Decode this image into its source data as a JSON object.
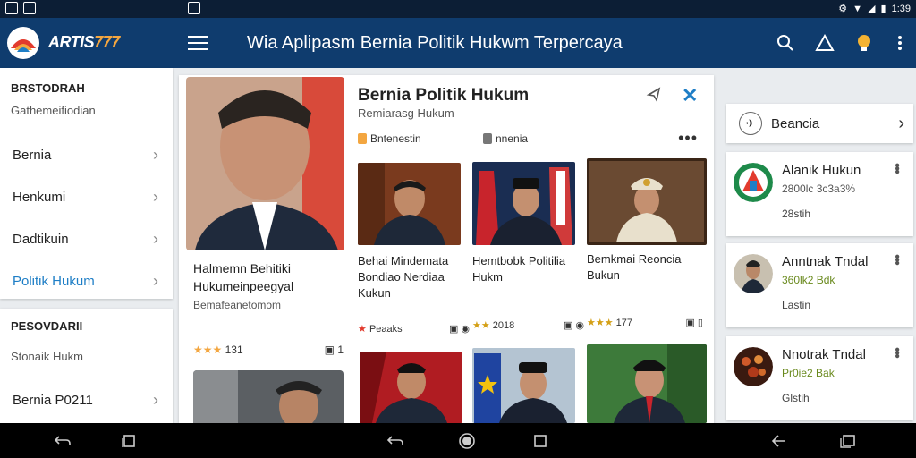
{
  "status": {
    "time": "1:39"
  },
  "app": {
    "brand_text": "ARTIS",
    "brand_num": "777",
    "title": "Wia Aplipasm Bernia Politik Hukwm Terpercaya"
  },
  "drawer": {
    "section1_heading": "BRSTODRAH",
    "section1_sub": "Gathemeifiodian",
    "items": [
      {
        "label": "Bernia"
      },
      {
        "label": "Henkumi"
      },
      {
        "label": "Dadtikuin"
      },
      {
        "label": "Politik Hukum"
      }
    ],
    "section2_heading": "PESOVDARII",
    "section2_sub": "Stonaik Hukm",
    "section2_item": "Bernia P0211"
  },
  "main": {
    "title": "Bernia Politik Hukum",
    "subtitle": "Remiarasg Hukum",
    "chip1": "Bntenestin",
    "chip2": "nnenia",
    "featured": {
      "title": "Halmemn Behitiki Hukumeinpeegyal",
      "subtitle": "Bemafeanetomom",
      "rating": "★★★",
      "count": "131",
      "comments": "1"
    },
    "articles": [
      {
        "caption": "Behai Mindemata Bondiao Nerdiaa Kukun",
        "rating": "★",
        "meta": "Peaaks"
      },
      {
        "caption": "Hemtbobk Politilia Hukm",
        "rating": "★★",
        "meta": "2018"
      },
      {
        "caption": "Bemkmai Reoncia Bukun",
        "rating": "★★★",
        "meta": "177"
      }
    ]
  },
  "right": {
    "search_label": "Beancia",
    "items": [
      {
        "title": "Alanik Hukun",
        "sub": "2800lc 3c3a3%",
        "date": "28stih"
      },
      {
        "title": "Anntnak Tndal",
        "sub": "360lk2 Bdk",
        "date": "Lastin"
      },
      {
        "title": "Nnotrak Tndal",
        "sub": "Pr0ie2 Bak",
        "date": "Glstih"
      }
    ]
  },
  "colors": {
    "appbar": "#0f3c6e",
    "accent": "#1e7ec6",
    "statusbar": "#0c1e35"
  }
}
